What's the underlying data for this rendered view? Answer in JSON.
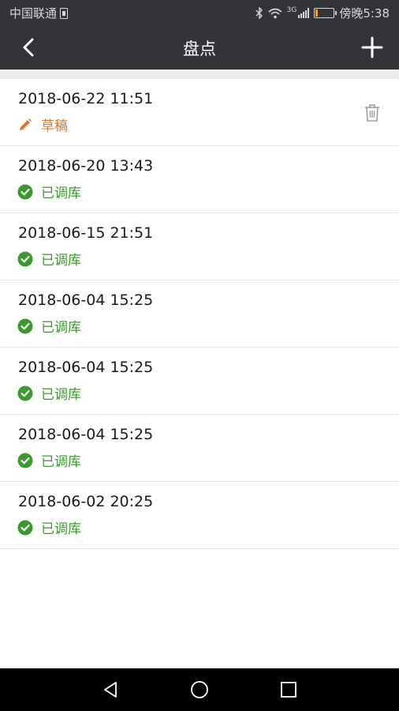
{
  "status_bar": {
    "carrier": "中国联通",
    "network_type": "3G",
    "battery_level": 0.15,
    "time": "傍晚5:38"
  },
  "header": {
    "title": "盘点",
    "back_icon": "chevron-left-icon",
    "add_icon": "plus-icon"
  },
  "colors": {
    "header_bg": "#333438",
    "draft": "#d9772a",
    "done": "#3a9a2c"
  },
  "records": [
    {
      "date": "2018-06-22 11:51",
      "status": "草稿",
      "state": "draft"
    },
    {
      "date": "2018-06-20 13:43",
      "status": "已调库",
      "state": "done"
    },
    {
      "date": "2018-06-15 21:51",
      "status": "已调库",
      "state": "done"
    },
    {
      "date": "2018-06-04 15:25",
      "status": "已调库",
      "state": "done"
    },
    {
      "date": "2018-06-04 15:25",
      "status": "已调库",
      "state": "done"
    },
    {
      "date": "2018-06-04 15:25",
      "status": "已调库",
      "state": "done"
    },
    {
      "date": "2018-06-02 20:25",
      "status": "已调库",
      "state": "done"
    }
  ],
  "nav_bar": {
    "back_icon": "triangle-back-icon",
    "home_icon": "circle-home-icon",
    "recents_icon": "square-recents-icon"
  }
}
